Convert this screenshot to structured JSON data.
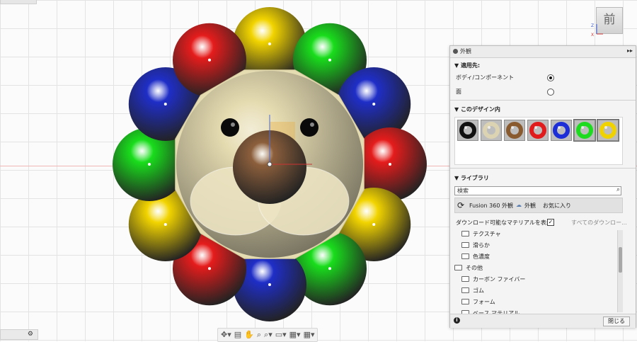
{
  "viewcube": {
    "label": "前",
    "axis_x": "X",
    "axis_z": "Z"
  },
  "bottom_left": {
    "icon": "settings-dot"
  },
  "nav_toolbar": {
    "icons": [
      "orbit-icon",
      "capture-icon",
      "pan-icon",
      "zoom-window-icon",
      "zoom-icon",
      "display-settings-icon",
      "visual-style-icon",
      "grid-icon"
    ]
  },
  "model": {
    "ball_colors": [
      "#f2d400",
      "#19dd1c",
      "#1f2ec7",
      "#e51c1c"
    ],
    "face_color": "#e5dbb0",
    "nose_color": "#8c5f3c"
  },
  "appearance_panel": {
    "title": "外観",
    "apply_to": {
      "title": "適用先:",
      "options": [
        {
          "label": "ボディ/コンポーネント",
          "selected": true
        },
        {
          "label": "面",
          "selected": false
        }
      ]
    },
    "in_design": {
      "title": "このデザイン内",
      "swatches": [
        {
          "name": "black",
          "color": "#111111",
          "selected": false
        },
        {
          "name": "cream",
          "color": "#dcd3b2",
          "selected": false
        },
        {
          "name": "brown",
          "color": "#8a5a2f",
          "selected": false
        },
        {
          "name": "red",
          "color": "#e11b1b",
          "selected": false
        },
        {
          "name": "blue",
          "color": "#1b2ed8",
          "selected": false
        },
        {
          "name": "green",
          "color": "#1ddc1f",
          "selected": true
        },
        {
          "name": "yellow",
          "color": "#f0d200",
          "selected": true
        }
      ]
    },
    "library": {
      "title": "ライブラリ",
      "search_placeholder": "検索",
      "tabs": [
        {
          "label": "Fusion 360 外観"
        },
        {
          "label": "外観"
        },
        {
          "label": "お気に入り"
        }
      ],
      "show_downloadable": "ダウンロード可能なマテリアルを表示",
      "show_downloadable_checked": true,
      "download_all": "すべてのダウンロー...",
      "tree": [
        {
          "label": "テクスチャ",
          "indent": 1
        },
        {
          "label": "滑らか",
          "indent": 1
        },
        {
          "label": "色濃度",
          "indent": 1
        },
        {
          "label": "その他",
          "indent": 0
        },
        {
          "label": "カーボン ファイバー",
          "indent": 1
        },
        {
          "label": "ゴム",
          "indent": 1
        },
        {
          "label": "フォーム",
          "indent": 1
        },
        {
          "label": "ベース マテリアル",
          "indent": 1
        }
      ]
    },
    "footer": {
      "close_label": "閉じる"
    }
  }
}
